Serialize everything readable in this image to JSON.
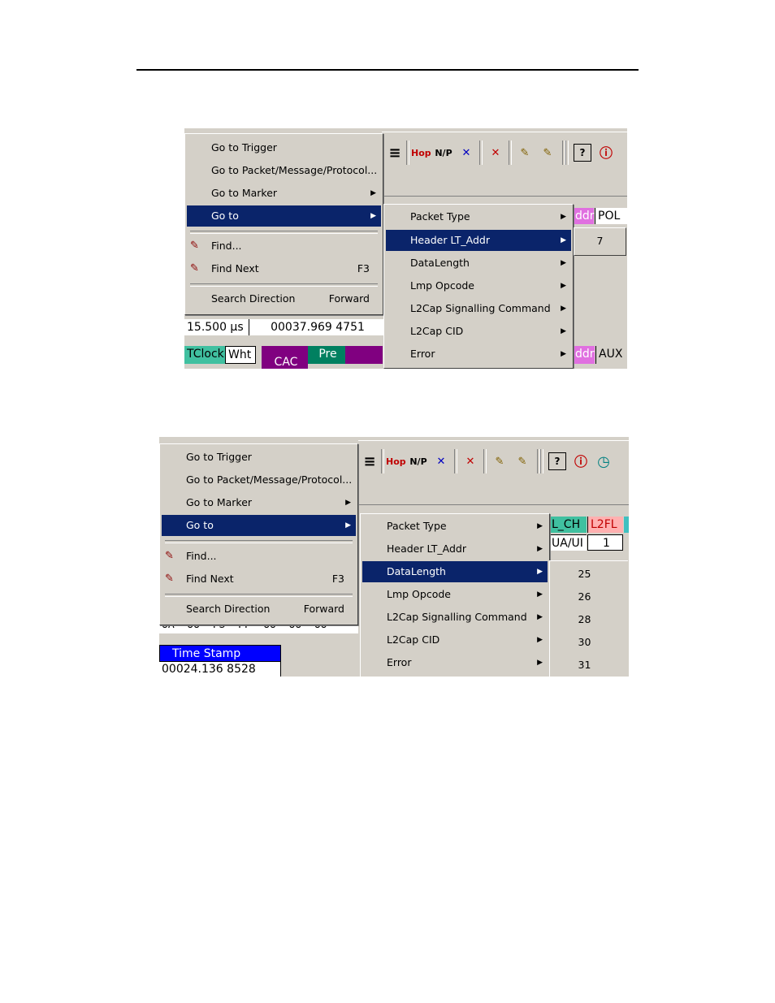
{
  "menu_items": {
    "goto_trigger": "Go to Trigger",
    "goto_packet": "Go to Packet/Message/Protocol...",
    "goto_marker": "Go to Marker",
    "goto": "Go to",
    "find": "Find...",
    "find_next": "Find Next",
    "find_next_accel": "F3",
    "search_direction": "Search Direction",
    "search_direction_value": "Forward"
  },
  "submenu_items": {
    "packet_type": "Packet Type",
    "header_lt_addr": "Header LT_Addr",
    "data_length": "DataLength",
    "lmp_opcode": "Lmp Opcode",
    "l2cap_signalling": "L2Cap Signalling Command",
    "l2cap_cid": "L2Cap CID",
    "error": "Error"
  },
  "shot1": {
    "lt_addr_values": [
      "7"
    ],
    "time_delta": "15.500 µs",
    "timestamp": "00037.969 4751",
    "columns": [
      "TClock",
      "Wht",
      "CAC",
      "Pre",
      "ddr",
      "AUX"
    ],
    "header_cells": [
      "ddr",
      "POL"
    ],
    "selected_submenu": "Header LT_Addr"
  },
  "shot2": {
    "data_length_values": [
      "25",
      "26",
      "28",
      "30",
      "31"
    ],
    "header_cells": [
      "L_CH",
      "L2FL"
    ],
    "row_cells": [
      "UA/UI",
      "1"
    ],
    "hex_row": "UA  UU  FS  FF  UU  UU  UU",
    "timestamp_header": "Time Stamp",
    "timestamp_value": "00024.136 8528",
    "selected_submenu": "DataLength"
  },
  "icons": [
    "flashlight-find-icon",
    "flashlight-find-next-icon",
    "hop-icon",
    "np-icon",
    "cross-icon",
    "question-icon",
    "alert-icon",
    "clock-icon"
  ]
}
